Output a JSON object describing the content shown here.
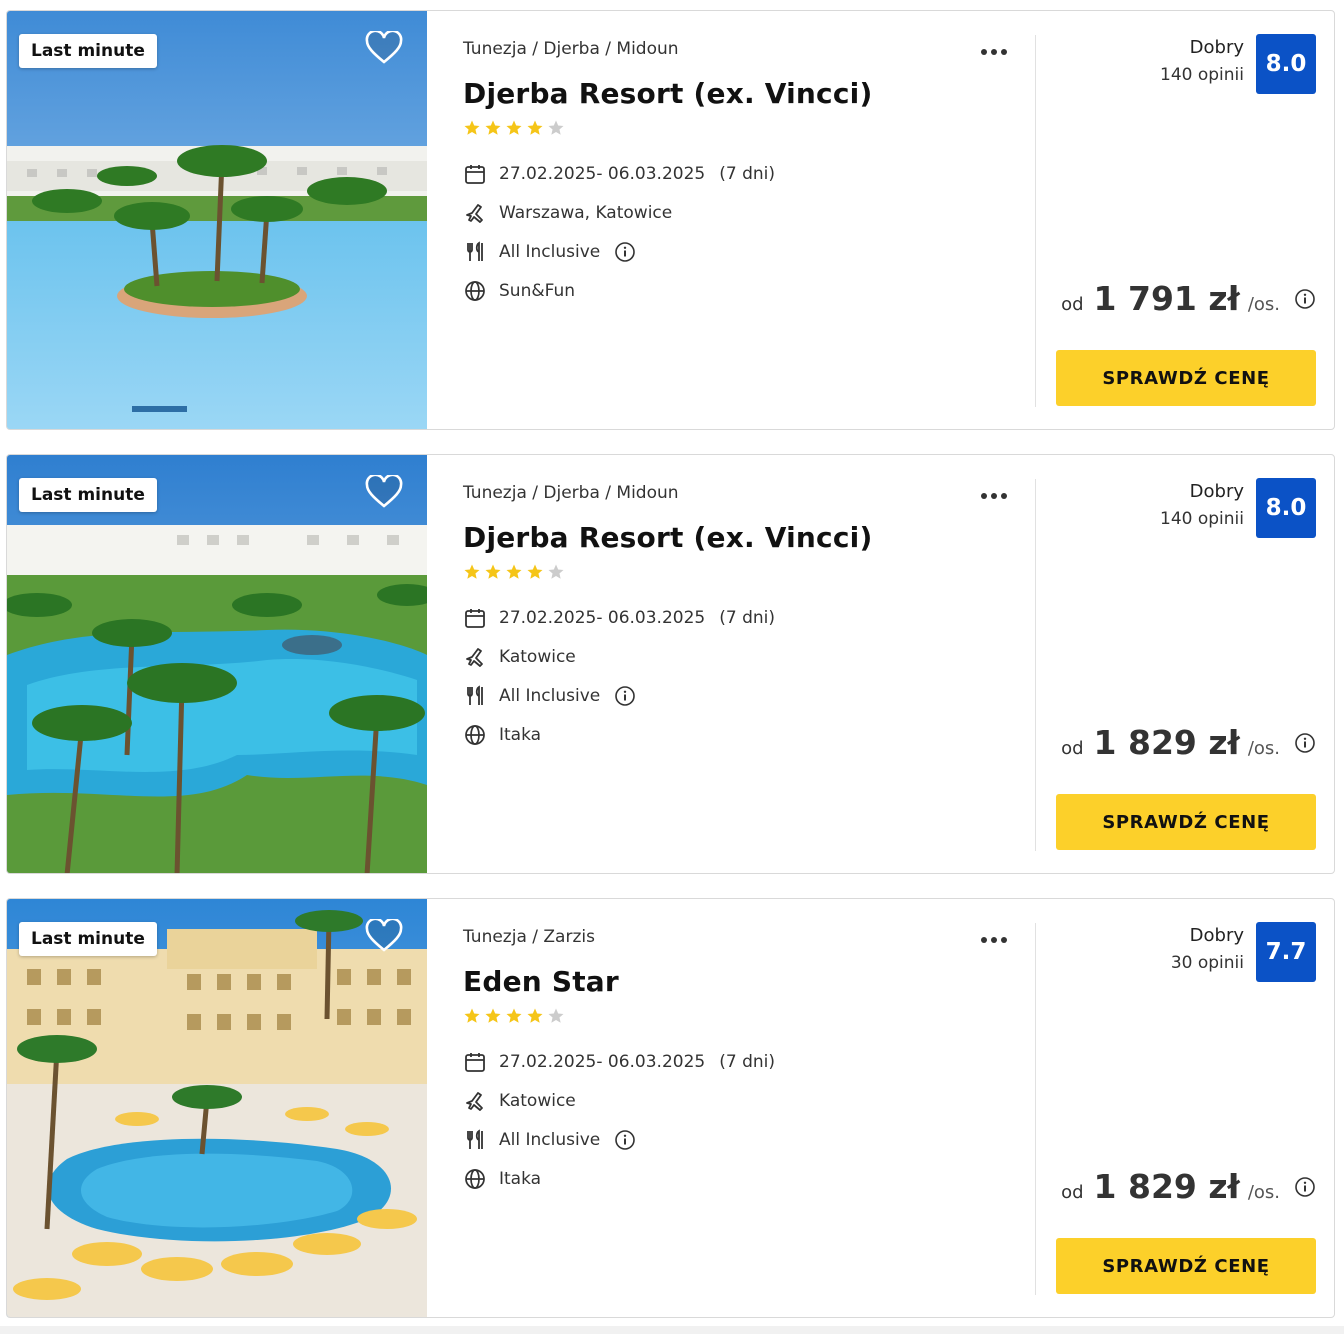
{
  "offers": [
    {
      "badge": "Last minute",
      "location": "Tunezja / Djerba / Midoun",
      "name": "Djerba Resort (ex. Vincci)",
      "stars": 4,
      "dates": "27.02.2025- 06.03.2025",
      "duration": "(7 dni)",
      "departure": "Warszawa, Katowice",
      "board": "All Inclusive",
      "operator": "Sun&Fun",
      "rating_label": "Dobry",
      "rating_count": "140 opinii",
      "score": "8.0",
      "price_prefix": "od",
      "price": "1 791 zł",
      "price_unit": "/os.",
      "cta": "SPRAWDŹ CENĘ"
    },
    {
      "badge": "Last minute",
      "location": "Tunezja / Djerba / Midoun",
      "name": "Djerba Resort (ex. Vincci)",
      "stars": 4,
      "dates": "27.02.2025- 06.03.2025",
      "duration": "(7 dni)",
      "departure": "Katowice",
      "board": "All Inclusive",
      "operator": "Itaka",
      "rating_label": "Dobry",
      "rating_count": "140 opinii",
      "score": "8.0",
      "price_prefix": "od",
      "price": "1 829 zł",
      "price_unit": "/os.",
      "cta": "SPRAWDŹ CENĘ"
    },
    {
      "badge": "Last minute",
      "location": "Tunezja / Zarzis",
      "name": "Eden Star",
      "stars": 4,
      "dates": "27.02.2025- 06.03.2025",
      "duration": "(7 dni)",
      "departure": "Katowice",
      "board": "All Inclusive",
      "operator": "Itaka",
      "rating_label": "Dobry",
      "rating_count": "30 opinii",
      "score": "7.7",
      "price_prefix": "od",
      "price": "1 829 zł",
      "price_unit": "/os.",
      "cta": "SPRAWDŹ CENĘ"
    }
  ],
  "colors": {
    "score_bg": "#0b52c6",
    "cta_bg": "#fcd02a",
    "star_on": "#f5c518",
    "star_off": "#cccccc"
  },
  "icons": {
    "favorite": "heart-outline-icon",
    "more": "more-horizontal-icon",
    "dates": "calendar-icon",
    "departure": "plane-icon",
    "board": "cutlery-icon",
    "operator": "globe-icon",
    "info": "info-circle-icon"
  }
}
